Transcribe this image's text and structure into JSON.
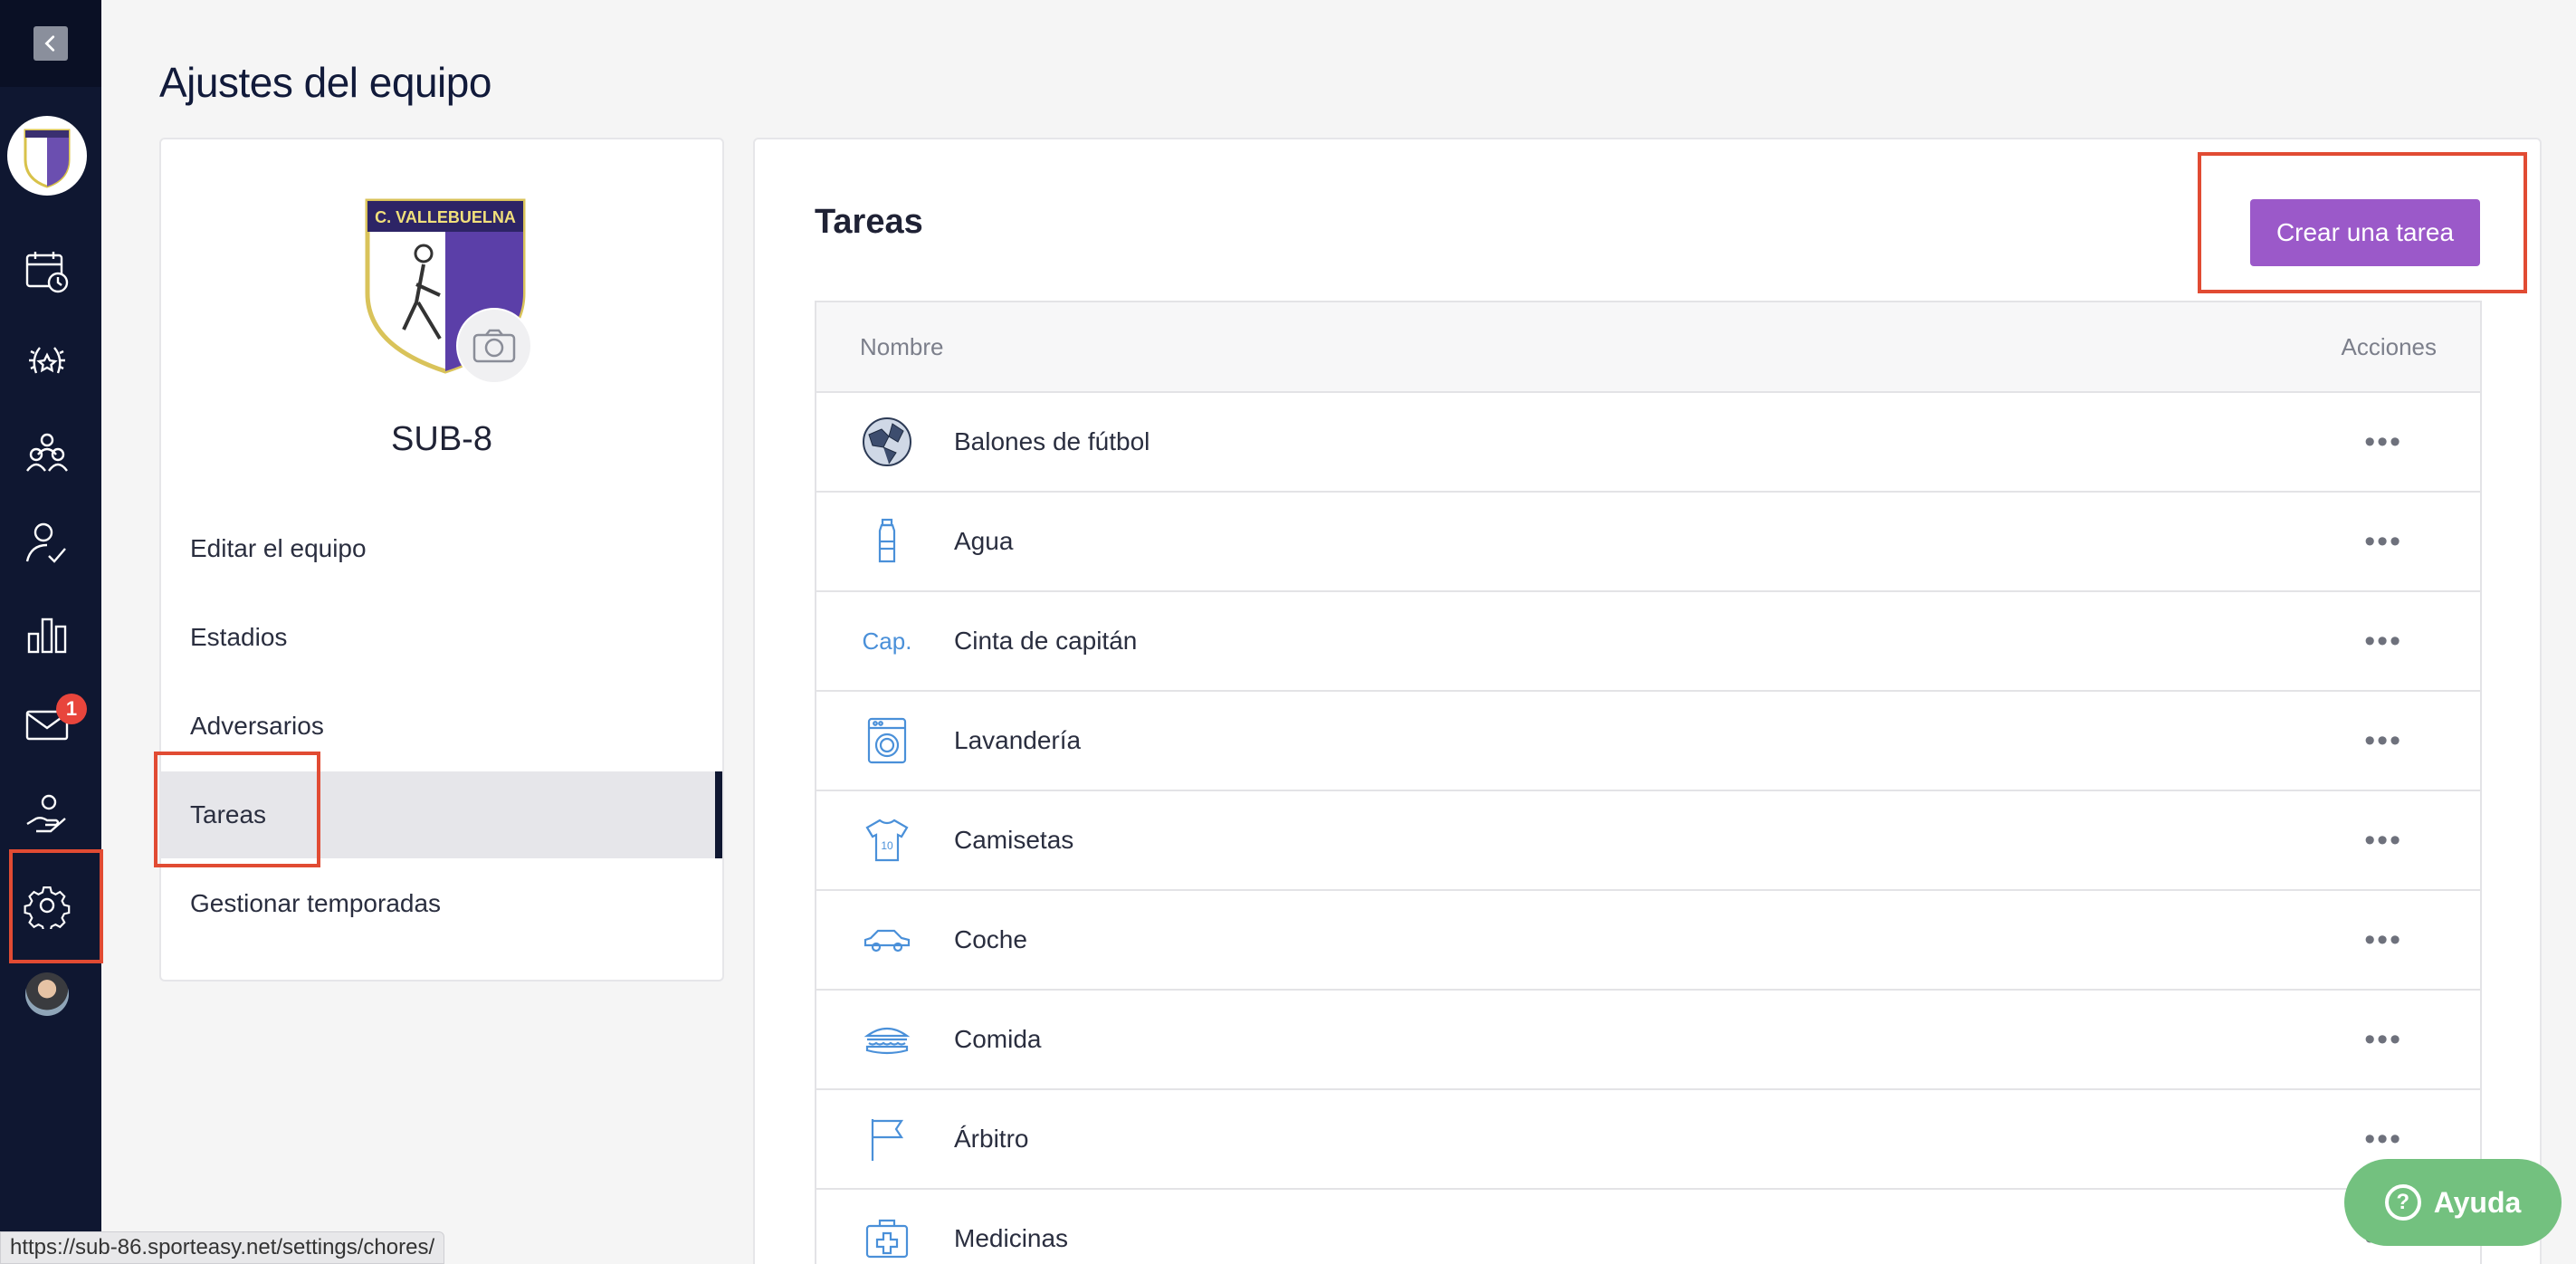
{
  "header": {
    "title": "Ajustes del equipo"
  },
  "nav": {
    "icons": [
      "back-icon",
      "calendar-icon",
      "trophy-icon",
      "team-icon",
      "attendance-icon",
      "stats-icon",
      "mail-icon",
      "volunteer-icon",
      "settings-icon"
    ],
    "mail_badge": "1",
    "active": "settings-icon"
  },
  "team": {
    "logo_text": "C. VALLEBUELNA",
    "name": "SUB-8"
  },
  "menu": {
    "items": [
      {
        "label": "Editar el equipo"
      },
      {
        "label": "Estadios"
      },
      {
        "label": "Adversarios"
      },
      {
        "label": "Tareas"
      },
      {
        "label": "Gestionar temporadas"
      }
    ],
    "active": "Tareas"
  },
  "tasks": {
    "title": "Tareas",
    "create_button": "Crear una tarea",
    "columns": {
      "name": "Nombre",
      "actions": "Acciones"
    },
    "actions_glyph": "•••",
    "rows": [
      {
        "icon": "soccer-ball-icon",
        "name": "Balones de fútbol"
      },
      {
        "icon": "water-bottle-icon",
        "name": "Agua"
      },
      {
        "icon": "captain-band-icon",
        "icon_text": "Cap.",
        "name": "Cinta de capitán"
      },
      {
        "icon": "washing-machine-icon",
        "name": "Lavandería"
      },
      {
        "icon": "jersey-icon",
        "name": "Camisetas"
      },
      {
        "icon": "car-icon",
        "name": "Coche"
      },
      {
        "icon": "sandwich-icon",
        "name": "Comida"
      },
      {
        "icon": "flag-icon",
        "name": "Árbitro"
      },
      {
        "icon": "first-aid-icon",
        "name": "Medicinas"
      }
    ]
  },
  "status_bar": {
    "url": "https://sub-86.sporteasy.net/settings/chores/"
  },
  "help": {
    "label": "Ayuda",
    "glyph": "?"
  },
  "colors": {
    "nav_bg": "#0f1731",
    "accent": "#9b59c9",
    "highlight": "#e14b33",
    "help": "#73c17f",
    "icon": "#4a90d9"
  }
}
